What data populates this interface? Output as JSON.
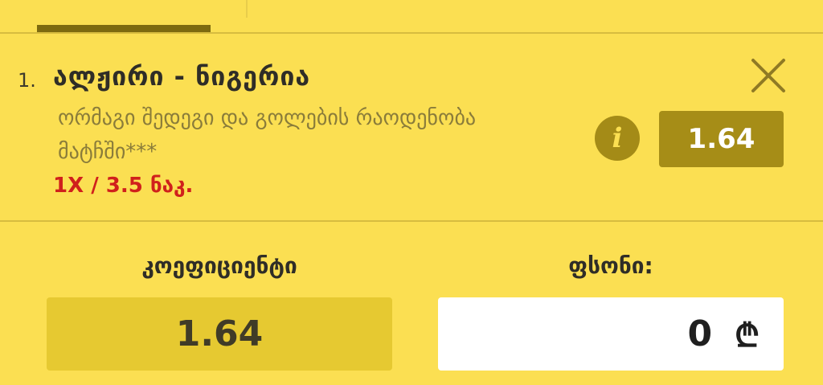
{
  "bet": {
    "index": "1.",
    "title": "ალჟირი - ნიგერია",
    "market": "ორმაგი შედეგი და გოლების რაოდენობა მატჩში***",
    "pick": "1X / 3.5 ნაკ.",
    "odds": "1.64"
  },
  "coefficient": {
    "label": "კოეფიციენტი",
    "value": "1.64"
  },
  "stake": {
    "label": "ფსონი:",
    "value": "0",
    "currency": "₾"
  },
  "icons": {
    "close": "close-icon",
    "info": "info-icon"
  },
  "colors": {
    "background": "#fbdf52",
    "accent_dark": "#a68d17",
    "pick_red": "#d0201c"
  }
}
